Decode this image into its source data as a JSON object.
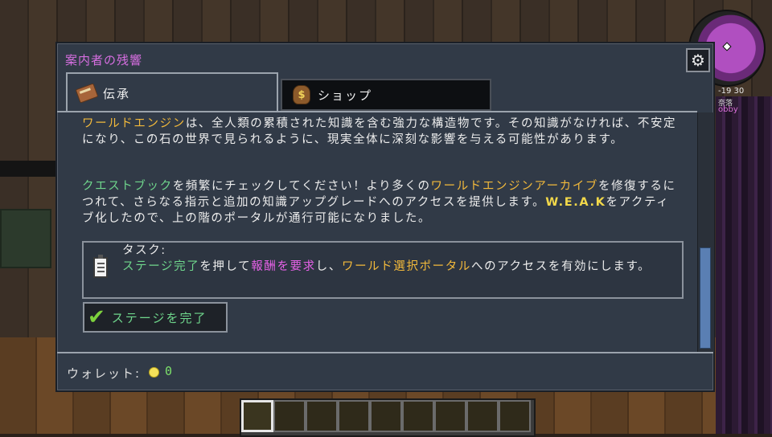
{
  "dialog": {
    "title": "案内者の残響",
    "settings_icon": "gear-icon"
  },
  "tabs": [
    {
      "label": "伝承",
      "icon": "book-icon",
      "active": true
    },
    {
      "label": "ショップ",
      "icon": "money-bag-icon",
      "active": false
    }
  ],
  "lore": {
    "p1": {
      "a": "ワールドエンジン",
      "b": "は、全人類の累積された知識を含む強力な構造物です。その知識がなければ、不安定になり、この石の世界で見られるように、現実全体に深刻な影響を与える可能性があります。"
    },
    "p2": {
      "a": "クエストブック",
      "b": "を頻繁にチェックしてください！より多くの",
      "c": "ワールドエンジンアーカイブ",
      "d": "を修復するにつれて、さらなる指示と追加の知識アップグレードへのアクセスを提供します。",
      "e": "W.E.A.K",
      "f": "をアクティブ化したので、上の階のポータルが通行可能になりました。"
    }
  },
  "task": {
    "header": "タスク:",
    "a": "ステージ完了",
    "b": "を押して",
    "c": "報酬を要求",
    "d": "し、",
    "e": "ワールド選択ポータル",
    "f": "へのアクセスを有効にします。",
    "icon": "clipboard-icon"
  },
  "complete_button": {
    "label": "ステージを完了",
    "icon": "checkmark-icon"
  },
  "wallet": {
    "label": "ウォレット:",
    "value": "0",
    "icon": "coin-icon"
  },
  "hud": {
    "coords": "-19 30",
    "label1": "奈落",
    "label2": "obby"
  },
  "hotbar": {
    "slots": 9,
    "selected": 0
  },
  "colors": {
    "title": "#d66ee0",
    "highlight_orange": "#f2b93b",
    "highlight_green": "#6fd68c",
    "highlight_magenta": "#e561e6",
    "panel_bg": "#313a47",
    "scroll_thumb": "#5a7fb3"
  }
}
